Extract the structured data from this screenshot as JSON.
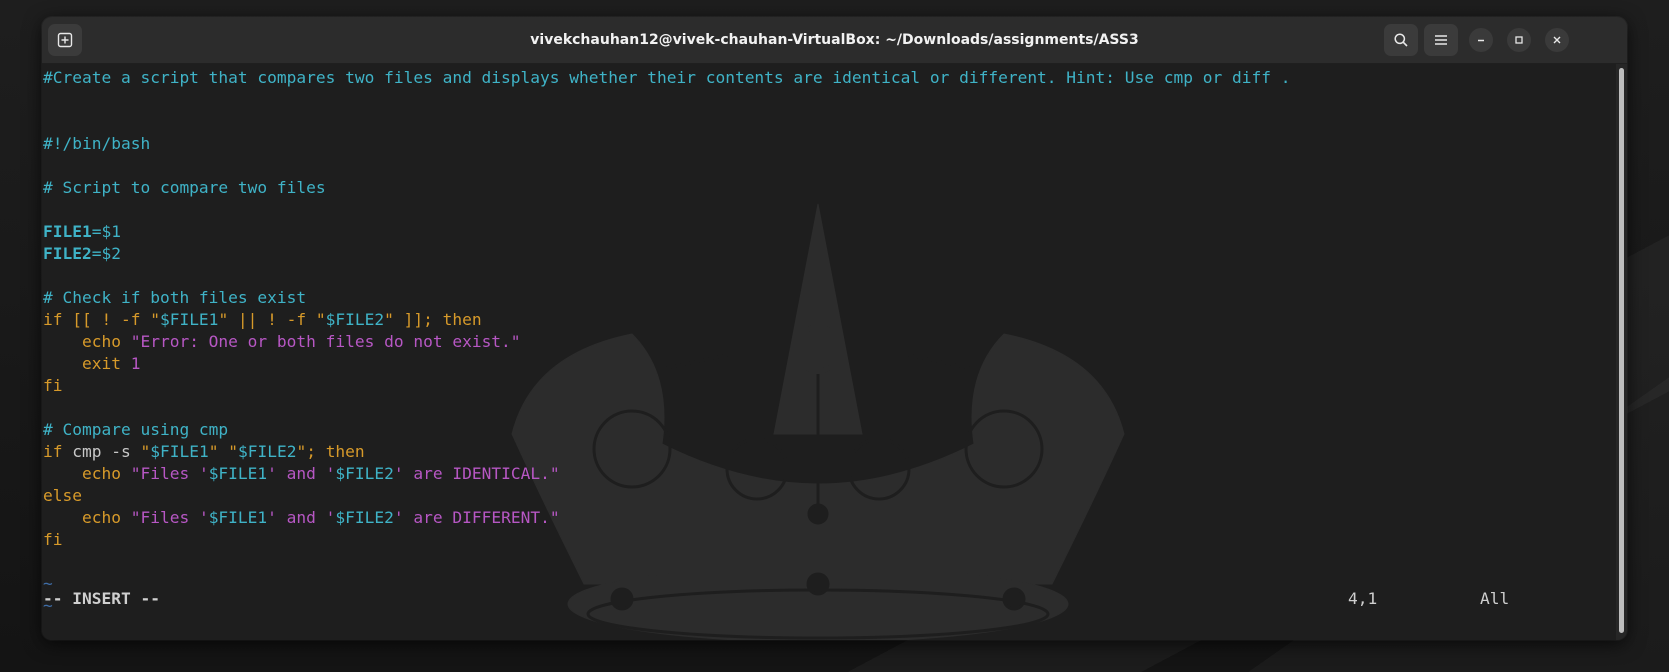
{
  "window": {
    "title": "vivekchauhan12@vivek-chauhan-VirtualBox: ~/Downloads/assignments/ASS3"
  },
  "icons": {
    "new_tab": "new-tab-icon",
    "search": "search-icon",
    "menu": "hamburger-menu-icon",
    "minimize": "minimize-icon",
    "maximize": "maximize-icon",
    "close": "close-icon"
  },
  "editor": {
    "lines": [
      {
        "segments": [
          {
            "t": "#Create a script that compares two files and displays whether their contents are identical or different. Hint: Use cmp or diff .",
            "c": "c-com"
          }
        ]
      },
      {
        "segments": []
      },
      {
        "segments": []
      },
      {
        "segments": [
          {
            "t": "#!/bin/bash",
            "c": "c-com"
          }
        ]
      },
      {
        "segments": []
      },
      {
        "segments": [
          {
            "t": "# Script to compare two files",
            "c": "c-com"
          }
        ]
      },
      {
        "segments": []
      },
      {
        "segments": [
          {
            "t": "FILE1",
            "c": "c-var"
          },
          {
            "t": "=$1",
            "c": "c-sv"
          }
        ]
      },
      {
        "segments": [
          {
            "t": "FILE2",
            "c": "c-var"
          },
          {
            "t": "=$2",
            "c": "c-sv"
          }
        ]
      },
      {
        "segments": []
      },
      {
        "segments": [
          {
            "t": "# Check if both files exist",
            "c": "c-com"
          }
        ]
      },
      {
        "segments": [
          {
            "t": "if [[ ! -f ",
            "c": "c-kw"
          },
          {
            "t": "\"",
            "c": "c-kw"
          },
          {
            "t": "$FILE1",
            "c": "c-sv"
          },
          {
            "t": "\" || ! -f \"",
            "c": "c-kw"
          },
          {
            "t": "$FILE2",
            "c": "c-sv"
          },
          {
            "t": "\" ]]; then",
            "c": "c-kw"
          }
        ]
      },
      {
        "segments": [
          {
            "t": "    echo ",
            "c": "c-kw"
          },
          {
            "t": "\"Error: One or both files do not exist.\"",
            "c": "c-str"
          }
        ]
      },
      {
        "segments": [
          {
            "t": "    exit ",
            "c": "c-kw"
          },
          {
            "t": "1",
            "c": "c-str"
          }
        ]
      },
      {
        "segments": [
          {
            "t": "fi",
            "c": "c-kw"
          }
        ]
      },
      {
        "segments": []
      },
      {
        "segments": [
          {
            "t": "# Compare using cmp",
            "c": "c-com"
          }
        ]
      },
      {
        "segments": [
          {
            "t": "if ",
            "c": "c-kw"
          },
          {
            "t": "cmp -s ",
            "c": "c-def"
          },
          {
            "t": "\"",
            "c": "c-kw"
          },
          {
            "t": "$FILE1",
            "c": "c-sv"
          },
          {
            "t": "\" \"",
            "c": "c-kw"
          },
          {
            "t": "$FILE2",
            "c": "c-sv"
          },
          {
            "t": "\"; then",
            "c": "c-kw"
          }
        ]
      },
      {
        "segments": [
          {
            "t": "    echo ",
            "c": "c-kw"
          },
          {
            "t": "\"Files '",
            "c": "c-str"
          },
          {
            "t": "$FILE1",
            "c": "c-sv"
          },
          {
            "t": "' and '",
            "c": "c-str"
          },
          {
            "t": "$FILE2",
            "c": "c-sv"
          },
          {
            "t": "' are IDENTICAL.\"",
            "c": "c-str"
          }
        ]
      },
      {
        "segments": [
          {
            "t": "else",
            "c": "c-kw"
          }
        ]
      },
      {
        "segments": [
          {
            "t": "    echo ",
            "c": "c-kw"
          },
          {
            "t": "\"Files '",
            "c": "c-str"
          },
          {
            "t": "$FILE1",
            "c": "c-sv"
          },
          {
            "t": "' and '",
            "c": "c-str"
          },
          {
            "t": "$FILE2",
            "c": "c-sv"
          },
          {
            "t": "' are DIFFERENT.\"",
            "c": "c-str"
          }
        ]
      },
      {
        "segments": [
          {
            "t": "fi",
            "c": "c-kw"
          }
        ]
      },
      {
        "segments": []
      },
      {
        "segments": [
          {
            "t": "~",
            "c": "c-tilde"
          }
        ]
      },
      {
        "segments": [
          {
            "t": "~",
            "c": "c-tilde"
          }
        ]
      }
    ],
    "mode": "-- INSERT --",
    "cursor_position": "4,1",
    "scroll_position": "All"
  },
  "colors": {
    "comment": "#3fb3c7",
    "keyword": "#d79a2a",
    "string": "#b757c4",
    "background": "#1e1e1e"
  }
}
